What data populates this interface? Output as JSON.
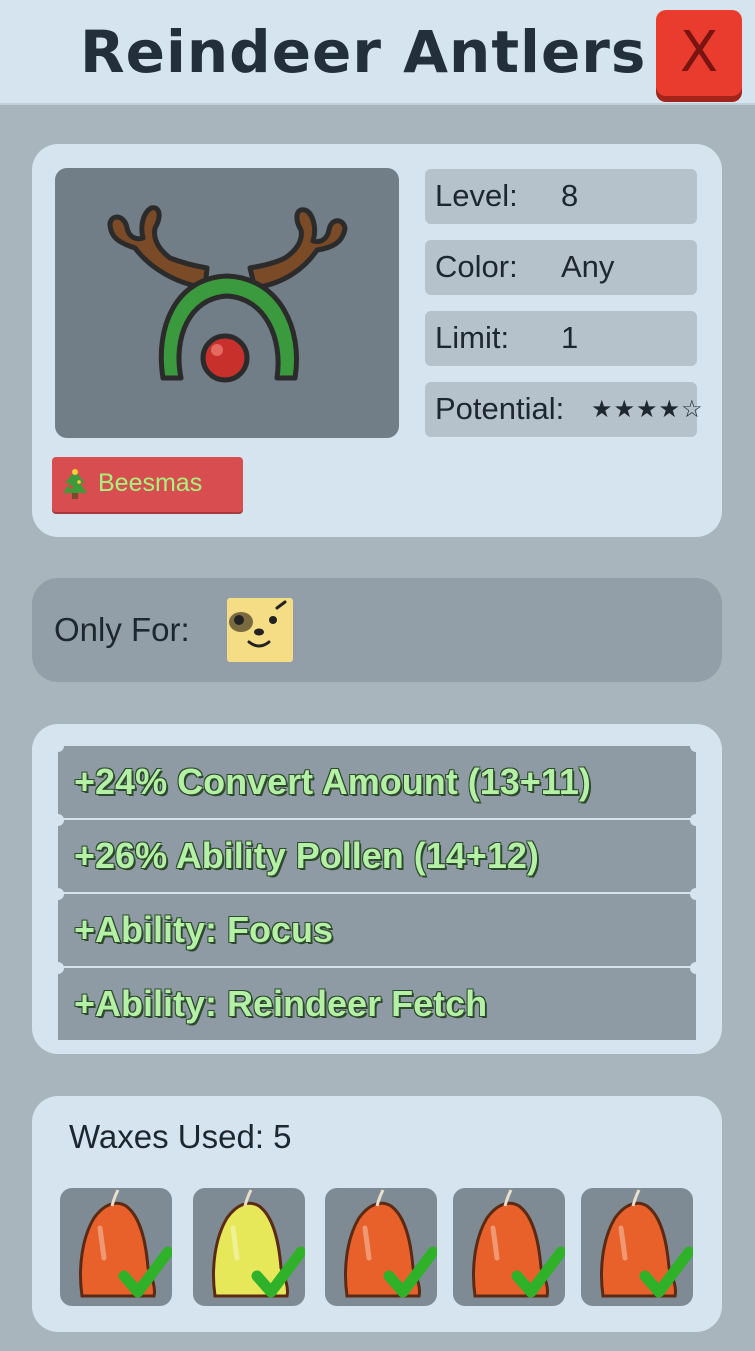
{
  "window": {
    "title": "Reindeer Antlers",
    "close_label": "X"
  },
  "item": {
    "icon": "reindeer-antlers-icon",
    "stats": [
      {
        "label": "Level:",
        "value": "8"
      },
      {
        "label": "Color:",
        "value": "Any"
      },
      {
        "label": "Limit:",
        "value": "1"
      },
      {
        "label": "Potential:",
        "value": "★★★★☆"
      }
    ],
    "event_badge": {
      "label": "Beesmas",
      "icon": "christmas-tree-icon",
      "color": "#d84e50",
      "text_color": "#a8f27e"
    }
  },
  "only_for": {
    "label": "Only For:",
    "icon": "bear-bee-icon"
  },
  "effects": [
    "+24% Convert Amount (13+11)",
    "+26% Ability Pollen (14+12)",
    "+Ability: Focus",
    "+Ability: Reindeer Fetch"
  ],
  "waxes": {
    "label": "Waxes Used: 5",
    "slots": [
      {
        "icon": "red-wax-icon",
        "color": "#e8612a",
        "success": true
      },
      {
        "icon": "yellow-wax-icon",
        "color": "#e6e85a",
        "success": true
      },
      {
        "icon": "red-wax-icon",
        "color": "#e8612a",
        "success": true
      },
      {
        "icon": "red-wax-icon",
        "color": "#e8612a",
        "success": true
      },
      {
        "icon": "red-wax-icon",
        "color": "#e8612a",
        "success": true
      }
    ]
  },
  "colors": {
    "panel": "#d6e4ef",
    "background": "#a9b5bd",
    "close_button": "#e93c2e",
    "effect_text": "#b4f1a6"
  }
}
